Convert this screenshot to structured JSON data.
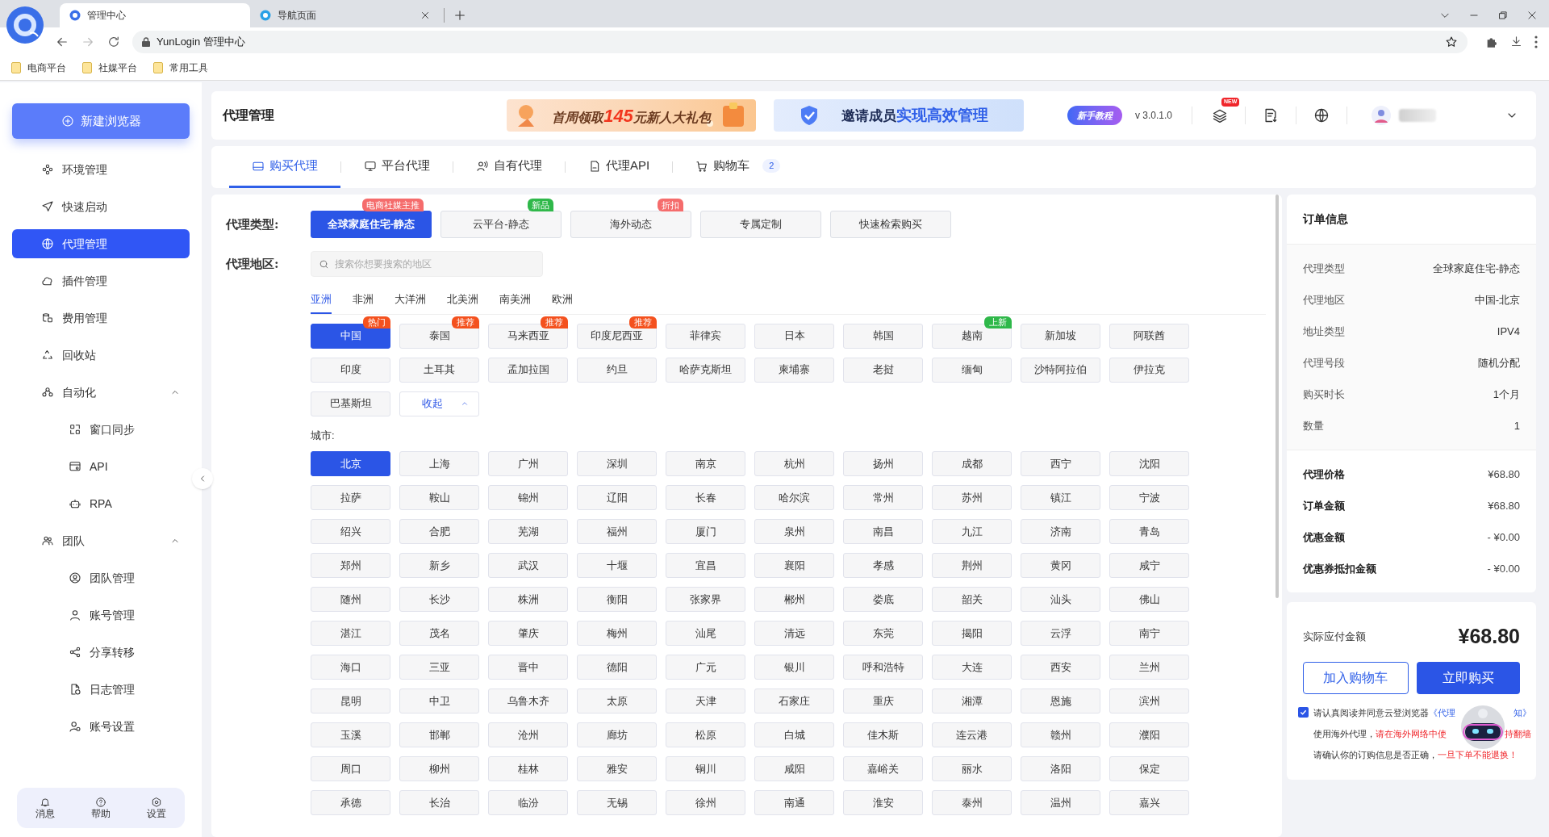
{
  "browser": {
    "tabs": [
      {
        "title": "管理中心",
        "selected": true
      },
      {
        "title": "导航页面",
        "selected": false
      }
    ],
    "address": "YunLogin 管理中心",
    "bookmarks": [
      "电商平台",
      "社媒平台",
      "常用工具"
    ]
  },
  "sidebar": {
    "new_button": "新建浏览器",
    "items": [
      {
        "label": "环境管理",
        "selected": false
      },
      {
        "label": "快速启动",
        "selected": false
      },
      {
        "label": "代理管理",
        "selected": true
      },
      {
        "label": "插件管理",
        "selected": false
      },
      {
        "label": "费用管理",
        "selected": false
      },
      {
        "label": "回收站",
        "selected": false
      },
      {
        "label": "自动化",
        "selected": false,
        "expanded": true,
        "children": [
          {
            "label": "窗口同步",
            "selected": false
          },
          {
            "label": "API",
            "selected": false
          },
          {
            "label": "RPA",
            "selected": false
          }
        ]
      },
      {
        "label": "团队",
        "selected": false,
        "expanded": true,
        "children": [
          {
            "label": "团队管理",
            "selected": false
          },
          {
            "label": "账号管理",
            "selected": false
          },
          {
            "label": "分享转移",
            "selected": false
          },
          {
            "label": "日志管理",
            "selected": false
          },
          {
            "label": "账号设置",
            "selected": false
          }
        ]
      }
    ],
    "footer": [
      "消息",
      "帮助",
      "设置"
    ]
  },
  "header": {
    "title": "代理管理",
    "promo": {
      "before": "首周领取",
      "highlight": "145",
      "after": "元新人大礼包"
    },
    "invite": {
      "before": "邀请成员",
      "highlight": "实现高效管理"
    },
    "tutorial": "新手教程",
    "version": "v 3.0.1.0",
    "new_badge": "NEW"
  },
  "tabs": [
    {
      "label": "购买代理",
      "selected": true
    },
    {
      "label": "平台代理",
      "selected": false
    },
    {
      "label": "自有代理",
      "selected": false
    },
    {
      "label": "代理API",
      "selected": false
    },
    {
      "label": "购物车",
      "selected": false,
      "count": "2"
    }
  ],
  "proxy_type": {
    "label": "代理类型:",
    "options": [
      {
        "label": "全球家庭住宅-静态",
        "selected": true,
        "tag": "电商社媒主推",
        "color": "#f56c6c"
      },
      {
        "label": "云平台-静态",
        "selected": false,
        "tag": "新品",
        "color": "#2fb84a"
      },
      {
        "label": "海外动态",
        "selected": false,
        "tag": "折扣",
        "color": "#f56c6c"
      },
      {
        "label": "专属定制",
        "selected": false
      },
      {
        "label": "快速检索购买",
        "selected": false
      }
    ]
  },
  "region": {
    "label": "代理地区:",
    "search_placeholder": "搜索你想要搜索的地区",
    "continents": [
      {
        "label": "亚洲",
        "selected": true
      },
      {
        "label": "非洲",
        "selected": false
      },
      {
        "label": "大洋洲",
        "selected": false
      },
      {
        "label": "北美洲",
        "selected": false
      },
      {
        "label": "南美洲",
        "selected": false
      },
      {
        "label": "欧洲",
        "selected": false
      }
    ],
    "countries": [
      {
        "label": "中国",
        "selected": true,
        "tag": "热门",
        "color": "#f4511e"
      },
      {
        "label": "泰国",
        "selected": false,
        "tag": "推荐",
        "color": "#f4511e"
      },
      {
        "label": "马来西亚",
        "selected": false,
        "tag": "推荐",
        "color": "#f4511e"
      },
      {
        "label": "印度尼西亚",
        "selected": false,
        "tag": "推荐",
        "color": "#f4511e"
      },
      {
        "label": "菲律宾",
        "selected": false
      },
      {
        "label": "日本",
        "selected": false
      },
      {
        "label": "韩国",
        "selected": false
      },
      {
        "label": "越南",
        "selected": false,
        "tag": "上新",
        "color": "#2fb84a"
      },
      {
        "label": "新加坡",
        "selected": false
      },
      {
        "label": "阿联酋",
        "selected": false
      },
      {
        "label": "印度",
        "selected": false
      },
      {
        "label": "土耳其",
        "selected": false
      },
      {
        "label": "孟加拉国",
        "selected": false
      },
      {
        "label": "约旦",
        "selected": false
      },
      {
        "label": "哈萨克斯坦",
        "selected": false
      },
      {
        "label": "柬埔寨",
        "selected": false
      },
      {
        "label": "老挝",
        "selected": false
      },
      {
        "label": "缅甸",
        "selected": false
      },
      {
        "label": "沙特阿拉伯",
        "selected": false
      },
      {
        "label": "伊拉克",
        "selected": false
      },
      {
        "label": "巴基斯坦",
        "selected": false
      }
    ],
    "collapse": "收起",
    "city_label": "城市:",
    "cities": [
      {
        "label": "北京",
        "selected": true
      },
      {
        "label": "上海",
        "selected": false
      },
      {
        "label": "广州",
        "selected": false
      },
      {
        "label": "深圳",
        "selected": false
      },
      {
        "label": "南京",
        "selected": false
      },
      {
        "label": "杭州",
        "selected": false
      },
      {
        "label": "扬州",
        "selected": false
      },
      {
        "label": "成都",
        "selected": false
      },
      {
        "label": "西宁",
        "selected": false
      },
      {
        "label": "沈阳",
        "selected": false
      },
      {
        "label": "拉萨",
        "selected": false
      },
      {
        "label": "鞍山",
        "selected": false
      },
      {
        "label": "锦州",
        "selected": false
      },
      {
        "label": "辽阳",
        "selected": false
      },
      {
        "label": "长春",
        "selected": false
      },
      {
        "label": "哈尔滨",
        "selected": false
      },
      {
        "label": "常州",
        "selected": false
      },
      {
        "label": "苏州",
        "selected": false
      },
      {
        "label": "镇江",
        "selected": false
      },
      {
        "label": "宁波",
        "selected": false
      },
      {
        "label": "绍兴",
        "selected": false
      },
      {
        "label": "合肥",
        "selected": false
      },
      {
        "label": "芜湖",
        "selected": false
      },
      {
        "label": "福州",
        "selected": false
      },
      {
        "label": "厦门",
        "selected": false
      },
      {
        "label": "泉州",
        "selected": false
      },
      {
        "label": "南昌",
        "selected": false
      },
      {
        "label": "九江",
        "selected": false
      },
      {
        "label": "济南",
        "selected": false
      },
      {
        "label": "青岛",
        "selected": false
      },
      {
        "label": "郑州",
        "selected": false
      },
      {
        "label": "新乡",
        "selected": false
      },
      {
        "label": "武汉",
        "selected": false
      },
      {
        "label": "十堰",
        "selected": false
      },
      {
        "label": "宜昌",
        "selected": false
      },
      {
        "label": "襄阳",
        "selected": false
      },
      {
        "label": "孝感",
        "selected": false
      },
      {
        "label": "荆州",
        "selected": false
      },
      {
        "label": "黄冈",
        "selected": false
      },
      {
        "label": "咸宁",
        "selected": false
      },
      {
        "label": "随州",
        "selected": false
      },
      {
        "label": "长沙",
        "selected": false
      },
      {
        "label": "株洲",
        "selected": false
      },
      {
        "label": "衡阳",
        "selected": false
      },
      {
        "label": "张家界",
        "selected": false
      },
      {
        "label": "郴州",
        "selected": false
      },
      {
        "label": "娄底",
        "selected": false
      },
      {
        "label": "韶关",
        "selected": false
      },
      {
        "label": "汕头",
        "selected": false
      },
      {
        "label": "佛山",
        "selected": false
      },
      {
        "label": "湛江",
        "selected": false
      },
      {
        "label": "茂名",
        "selected": false
      },
      {
        "label": "肇庆",
        "selected": false
      },
      {
        "label": "梅州",
        "selected": false
      },
      {
        "label": "汕尾",
        "selected": false
      },
      {
        "label": "清远",
        "selected": false
      },
      {
        "label": "东莞",
        "selected": false
      },
      {
        "label": "揭阳",
        "selected": false
      },
      {
        "label": "云浮",
        "selected": false
      },
      {
        "label": "南宁",
        "selected": false
      },
      {
        "label": "海口",
        "selected": false
      },
      {
        "label": "三亚",
        "selected": false
      },
      {
        "label": "晋中",
        "selected": false
      },
      {
        "label": "德阳",
        "selected": false
      },
      {
        "label": "广元",
        "selected": false
      },
      {
        "label": "银川",
        "selected": false
      },
      {
        "label": "呼和浩特",
        "selected": false
      },
      {
        "label": "大连",
        "selected": false
      },
      {
        "label": "西安",
        "selected": false
      },
      {
        "label": "兰州",
        "selected": false
      },
      {
        "label": "昆明",
        "selected": false
      },
      {
        "label": "中卫",
        "selected": false
      },
      {
        "label": "乌鲁木齐",
        "selected": false
      },
      {
        "label": "太原",
        "selected": false
      },
      {
        "label": "天津",
        "selected": false
      },
      {
        "label": "石家庄",
        "selected": false
      },
      {
        "label": "重庆",
        "selected": false
      },
      {
        "label": "湘潭",
        "selected": false
      },
      {
        "label": "恩施",
        "selected": false
      },
      {
        "label": "滨州",
        "selected": false
      },
      {
        "label": "玉溪",
        "selected": false
      },
      {
        "label": "邯郸",
        "selected": false
      },
      {
        "label": "沧州",
        "selected": false
      },
      {
        "label": "廊坊",
        "selected": false
      },
      {
        "label": "松原",
        "selected": false
      },
      {
        "label": "白城",
        "selected": false
      },
      {
        "label": "佳木斯",
        "selected": false
      },
      {
        "label": "连云港",
        "selected": false
      },
      {
        "label": "赣州",
        "selected": false
      },
      {
        "label": "濮阳",
        "selected": false
      },
      {
        "label": "周口",
        "selected": false
      },
      {
        "label": "柳州",
        "selected": false
      },
      {
        "label": "桂林",
        "selected": false
      },
      {
        "label": "雅安",
        "selected": false
      },
      {
        "label": "铜川",
        "selected": false
      },
      {
        "label": "咸阳",
        "selected": false
      },
      {
        "label": "嘉峪关",
        "selected": false
      },
      {
        "label": "丽水",
        "selected": false
      },
      {
        "label": "洛阳",
        "selected": false
      },
      {
        "label": "保定",
        "selected": false
      },
      {
        "label": "承德",
        "selected": false
      },
      {
        "label": "长治",
        "selected": false
      },
      {
        "label": "临汾",
        "selected": false
      },
      {
        "label": "无锡",
        "selected": false
      },
      {
        "label": "徐州",
        "selected": false
      },
      {
        "label": "南通",
        "selected": false
      },
      {
        "label": "淮安",
        "selected": false
      },
      {
        "label": "泰州",
        "selected": false
      },
      {
        "label": "温州",
        "selected": false
      },
      {
        "label": "嘉兴",
        "selected": false
      }
    ]
  },
  "order": {
    "title": "订单信息",
    "info": [
      {
        "label": "代理类型",
        "value": "全球家庭住宅-静态"
      },
      {
        "label": "代理地区",
        "value": "中国-北京"
      },
      {
        "label": "地址类型",
        "value": "IPV4"
      },
      {
        "label": "代理号段",
        "value": "随机分配"
      },
      {
        "label": "购买时长",
        "value": "1个月"
      },
      {
        "label": "数量",
        "value": "1"
      }
    ],
    "pricing": [
      {
        "label": "代理价格",
        "value": "¥68.80"
      },
      {
        "label": "订单金额",
        "value": "¥68.80"
      },
      {
        "label": "优惠金额",
        "value": "- ¥0.00"
      },
      {
        "label": "优惠券抵扣金额",
        "value": "- ¥0.00"
      }
    ],
    "payable_label": "实际应付金额",
    "payable_value": "¥68.80",
    "add_cart": "加入购物车",
    "buy_now": "立即购买",
    "agreement": {
      "checked": true,
      "lines": [
        [
          {
            "text": "请认真阅读并同意云登浏览器",
            "kind": "plain"
          },
          {
            "text": "《代理",
            "kind": "link"
          },
          {
            "text": "知》",
            "kind": "link",
            "after_gap": true
          }
        ],
        [
          {
            "text": "使用海外代理，",
            "kind": "plain"
          },
          {
            "text": "请在海外网络中使",
            "kind": "warning"
          },
          {
            "text": "持翻墙",
            "kind": "warning",
            "after_gap": true
          }
        ],
        [
          {
            "text": "请确认你的订购信息是否正确，",
            "kind": "plain"
          },
          {
            "text": "一旦下单不能退换！",
            "kind": "warning"
          }
        ]
      ]
    }
  }
}
